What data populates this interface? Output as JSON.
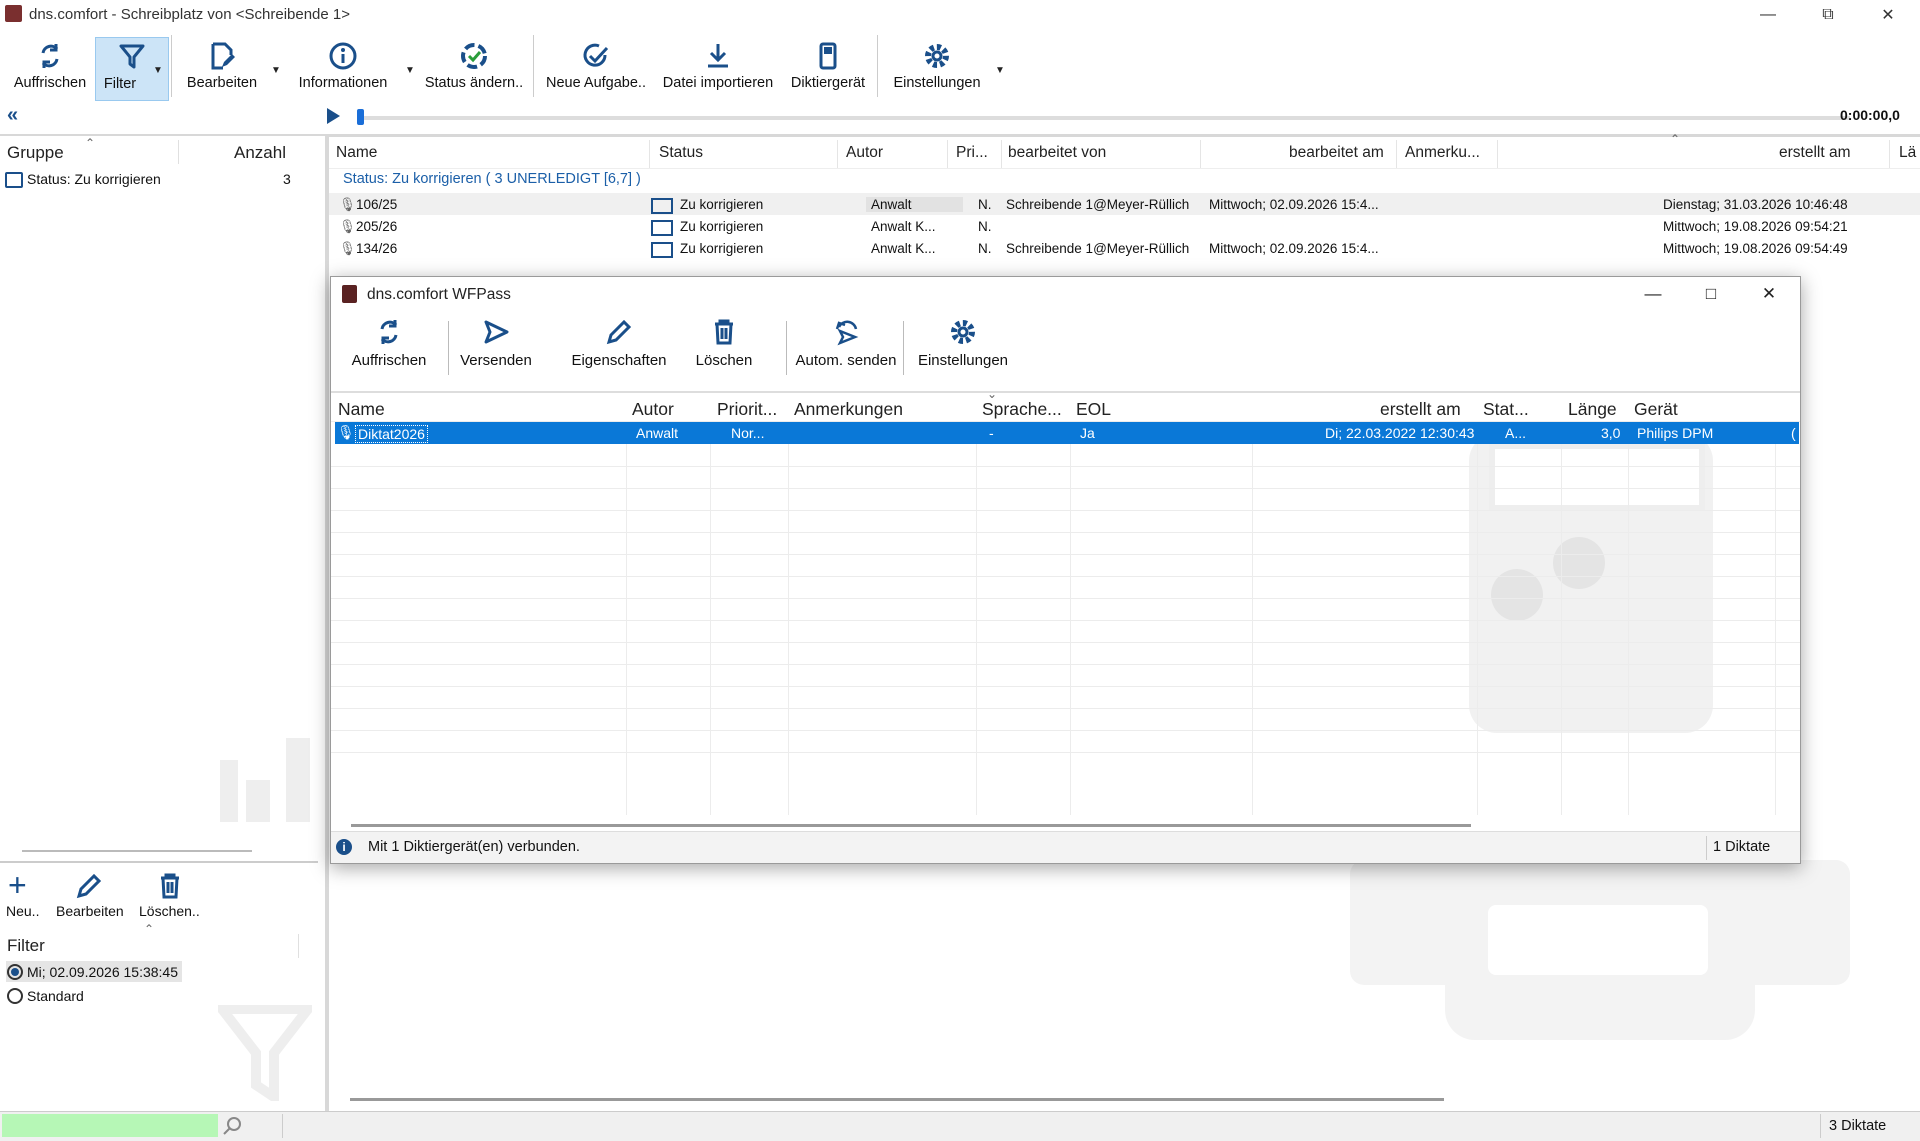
{
  "window": {
    "title": "dns.comfort - Schreibplatz von <Schreibende 1>"
  },
  "toolbar": {
    "refresh": "Auffrischen",
    "filter": "Filter",
    "edit": "Bearbeiten",
    "info": "Informationen",
    "status_change": "Status ändern..",
    "new_task": "Neue Aufgabe..",
    "import_file": "Datei importieren",
    "dictation_device": "Diktiergerät",
    "settings": "Einstellungen"
  },
  "player": {
    "time": "0:00:00,0"
  },
  "group_panel": {
    "col_group": "Gruppe",
    "col_count": "Anzahl",
    "rows": [
      {
        "label": "Status: Zu korrigieren",
        "count": "3"
      }
    ]
  },
  "bottom_toolbar": {
    "new": "Neu..",
    "edit": "Bearbeiten",
    "delete": "Löschen.."
  },
  "filter_panel": {
    "title": "Filter",
    "options": [
      {
        "label": "Mi; 02.09.2026 15:38:45",
        "selected": true
      },
      {
        "label": "Standard",
        "selected": false
      }
    ]
  },
  "main_list": {
    "columns": [
      "Name",
      "Status",
      "Autor",
      "Pri...",
      "bearbeitet von",
      "bearbeitet am",
      "Anmerku...",
      "erstellt am",
      "Lä"
    ],
    "group_header": "Status: Zu korrigieren ( 3 UNERLEDIGT [6,7] )",
    "rows": [
      {
        "name": "106/25",
        "status": "Zu korrigieren",
        "author": "Anwalt",
        "priority": "N.",
        "edited_by": "Schreibende 1@Meyer-Rüllich",
        "edited_at": "Mittwoch; 02.09.2026 15:4...",
        "created_at": "Dienstag; 31.03.2026 10:46:48"
      },
      {
        "name": "205/26",
        "status": "Zu korrigieren",
        "author": "Anwalt K...",
        "priority": "N.",
        "edited_by": "",
        "edited_at": "",
        "created_at": "Mittwoch; 19.08.2026 09:54:21"
      },
      {
        "name": "134/26",
        "status": "Zu korrigieren",
        "author": "Anwalt K...",
        "priority": "N.",
        "edited_by": "Schreibende 1@Meyer-Rüllich",
        "edited_at": "Mittwoch; 02.09.2026 15:4...",
        "created_at": "Mittwoch; 19.08.2026 09:54:49"
      }
    ]
  },
  "dialog": {
    "title": "dns.comfort WFPass",
    "toolbar": {
      "refresh": "Auffrischen",
      "send": "Versenden",
      "properties": "Eigenschaften",
      "delete": "Löschen",
      "auto_send": "Autom. senden",
      "settings": "Einstellungen"
    },
    "columns": [
      "Name",
      "Autor",
      "Priorit...",
      "Anmerkungen",
      "Sprache...",
      "EOL",
      "erstellt am",
      "Stat...",
      "Länge",
      "Gerät"
    ],
    "rows": [
      {
        "name": "Diktat2026",
        "author": "Anwalt",
        "priority": "Nor...",
        "notes": "",
        "language": "-",
        "eol": "Ja",
        "created_at": "Di; 22.03.2022 12:30:43",
        "status": "A...",
        "length": "3,0",
        "device": "Philips DPM",
        "extra": "("
      }
    ],
    "status_text": "Mit 1 Diktiergerät(en) verbunden.",
    "count_text": "1 Diktate"
  },
  "statusbar": {
    "count": "3 Diktate"
  },
  "colors": {
    "accent": "#0a78d7",
    "icon_blue": "#1a4f8a",
    "group_text": "#1b5fa8",
    "progress_green": "#b6f7b6"
  }
}
